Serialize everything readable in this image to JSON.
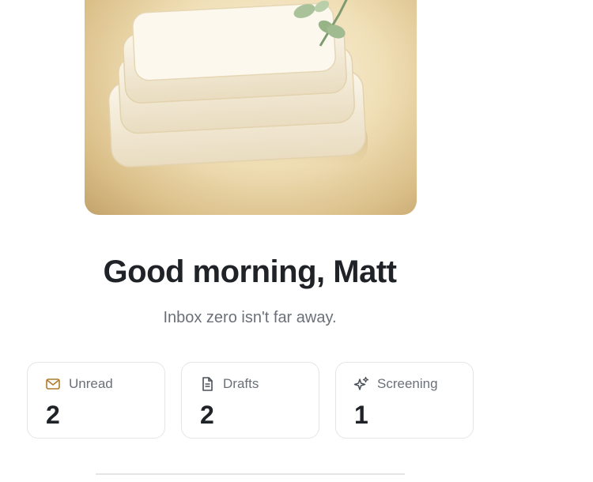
{
  "greeting": {
    "title": "Good morning, Matt",
    "subtitle": "Inbox zero isn't far away."
  },
  "stats": [
    {
      "label": "Unread",
      "count": "2",
      "icon": "mail-icon",
      "icon_color": "#b07b2c"
    },
    {
      "label": "Drafts",
      "count": "2",
      "icon": "document-icon",
      "icon_color": "#4a5058"
    },
    {
      "label": "Screening",
      "count": "1",
      "icon": "sparkles-icon",
      "icon_color": "#4a5058"
    }
  ],
  "colors": {
    "text_primary": "#1f2328",
    "text_secondary": "#6b7078",
    "card_border": "#e3e5e8",
    "hero_warm": "#f0dfb6"
  }
}
